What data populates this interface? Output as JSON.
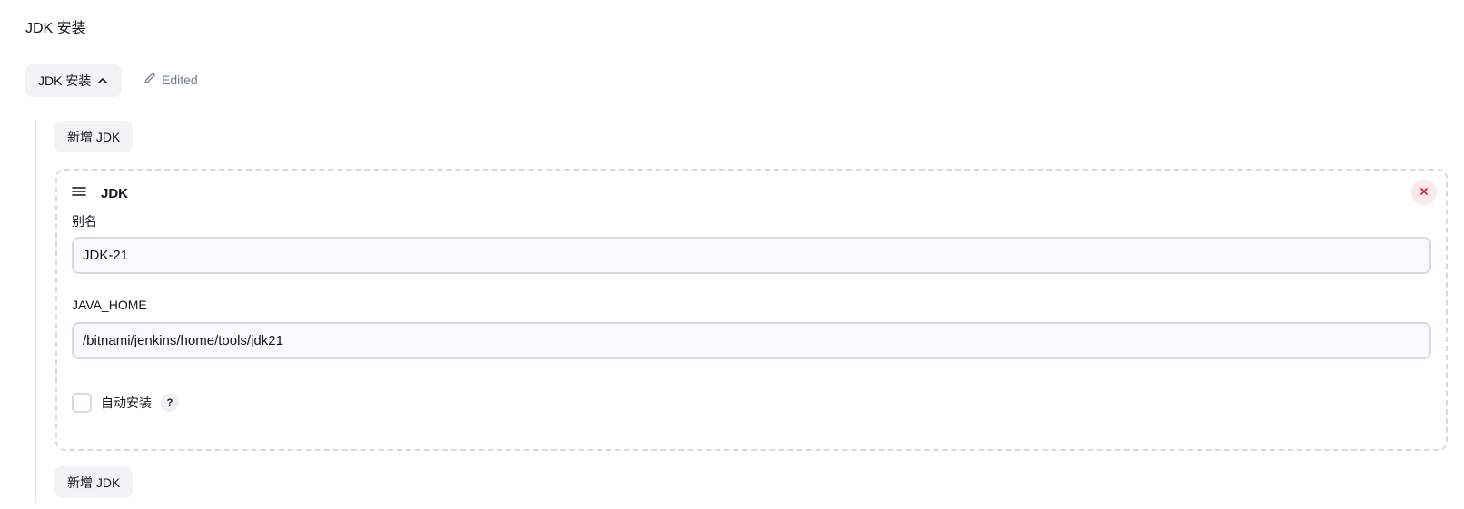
{
  "section": {
    "title": "JDK 安装"
  },
  "toggle": {
    "label": "JDK 安装",
    "icon": "chevron-up-icon"
  },
  "status": {
    "edited_label": "Edited",
    "icon": "pencil-icon"
  },
  "add_button": {
    "top_label": "新增 JDK",
    "bottom_label": "新增 JDK"
  },
  "jdk_item": {
    "title": "JDK",
    "drag_icon": "drag-handle-icon",
    "delete_icon": "close-icon",
    "alias": {
      "label": "别名",
      "value": "JDK-21"
    },
    "java_home": {
      "label": "JAVA_HOME",
      "value": "/bitnami/jenkins/home/tools/jdk21"
    },
    "auto_install": {
      "label": "自动安装",
      "checked": false,
      "help": "?"
    }
  },
  "colors": {
    "button_bg": "#f2f3f5",
    "edited_text": "#6b7a90",
    "delete_icon": "#e0143c",
    "delete_bg": "#fde8ea",
    "card_border": "#d6dae0"
  }
}
